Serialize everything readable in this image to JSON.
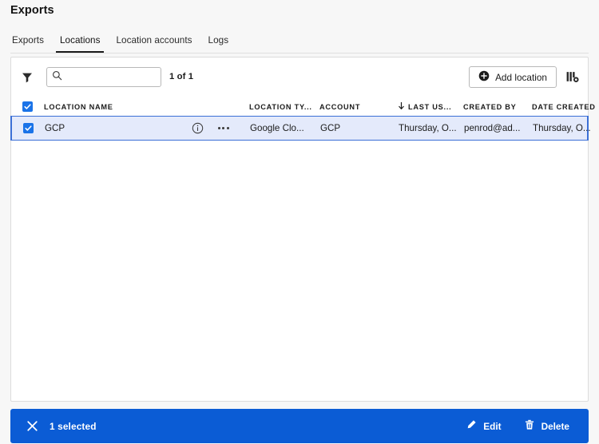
{
  "header": {
    "title": "Exports",
    "tabs": [
      {
        "label": "Exports",
        "active": false
      },
      {
        "label": "Locations",
        "active": true
      },
      {
        "label": "Location accounts",
        "active": false
      },
      {
        "label": "Logs",
        "active": false
      }
    ]
  },
  "toolbar": {
    "filter_icon": "filter-icon",
    "search": {
      "value": "",
      "placeholder": "",
      "icon": "search-icon"
    },
    "count_label": "1 of 1",
    "add_button": {
      "label": "Add location",
      "icon": "plus-circle-icon"
    },
    "column_settings_icon": "columns-settings-icon"
  },
  "table": {
    "select_all_checked": true,
    "columns": [
      {
        "key": "name",
        "label": "LOCATION NAME"
      },
      {
        "key": "type",
        "label": "LOCATION TY..."
      },
      {
        "key": "account",
        "label": "ACCOUNT"
      },
      {
        "key": "last_used",
        "label": "LAST US...",
        "sorted": true,
        "sort_dir": "desc",
        "sort_icon": "arrow-down-icon"
      },
      {
        "key": "created_by",
        "label": "CREATED BY"
      },
      {
        "key": "date_created",
        "label": "DATE CREATED"
      }
    ],
    "rows": [
      {
        "selected": true,
        "name": "GCP",
        "info_icon": "info-icon",
        "more_icon": "more-options-icon",
        "type": "Google Clo...",
        "account": "GCP",
        "last_used": "Thursday, O...",
        "created_by": "penrod@ad...",
        "date_created": "Thursday, O..."
      }
    ]
  },
  "action_bar": {
    "close_icon": "close-icon",
    "selection_label": "1 selected",
    "actions": [
      {
        "label": "Edit",
        "icon": "pencil-icon"
      },
      {
        "label": "Delete",
        "icon": "trash-icon"
      }
    ]
  },
  "colors": {
    "accent_blue": "#0b5cd5",
    "checkbox_blue": "#1a73e8",
    "selected_row_bg": "#e4eafb",
    "selected_row_border": "#3b6fd6",
    "page_bg": "#f7f7f7",
    "card_bg": "#ffffff"
  }
}
